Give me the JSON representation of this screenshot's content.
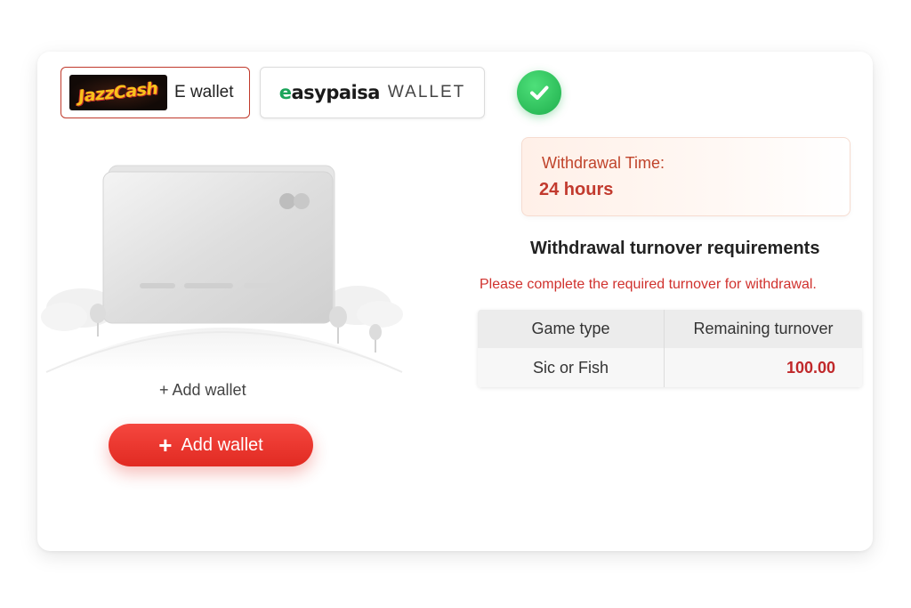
{
  "tabs": {
    "jazzcash": {
      "logo_text": "JazzCash",
      "label": "E wallet"
    },
    "easypaisa": {
      "brand_e": "e",
      "brand_rest": "asypaisa",
      "label": "WALLET"
    }
  },
  "status": {
    "icon": "check-icon",
    "color": "#22b24f"
  },
  "wallet": {
    "add_text": "+ Add wallet",
    "add_button_label": "Add wallet",
    "add_button_icon": "plus-icon"
  },
  "withdrawal": {
    "time_label": "Withdrawal Time:",
    "time_value": "24 hours"
  },
  "requirements": {
    "title": "Withdrawal turnover requirements",
    "note": "Please complete the required turnover for withdrawal.",
    "columns": [
      "Game type",
      "Remaining turnover"
    ],
    "rows": [
      {
        "game_type": "Sic or Fish",
        "remaining": "100.00"
      }
    ]
  },
  "colors": {
    "accent_red": "#e12a22",
    "success_green": "#22b24f"
  }
}
